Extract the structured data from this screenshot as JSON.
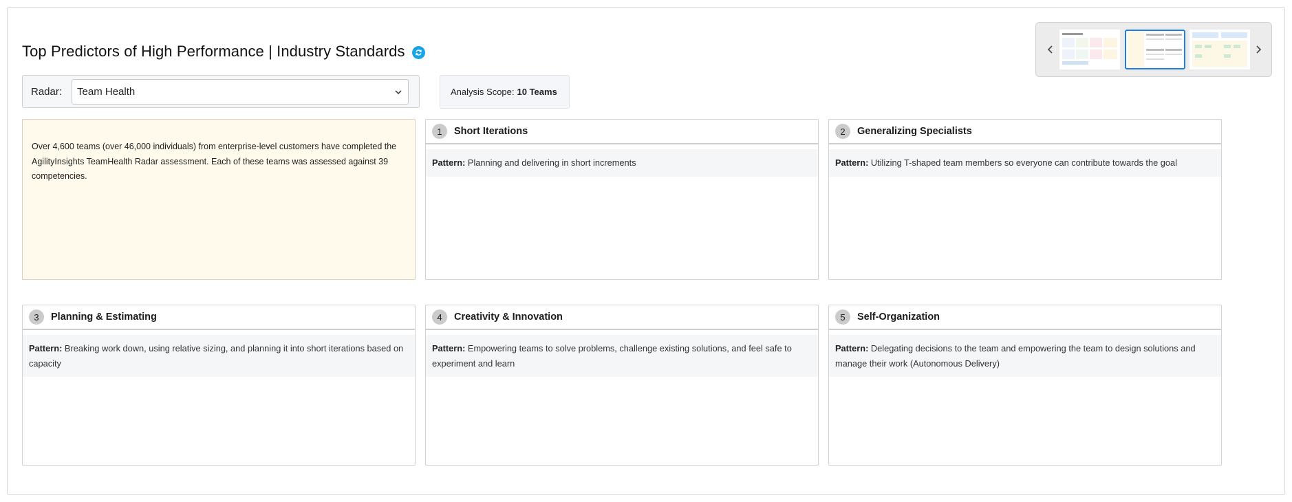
{
  "page": {
    "title": "Top Predictors of High Performance | Industry Standards"
  },
  "radar": {
    "label": "Radar:",
    "selected": "Team Health"
  },
  "scope": {
    "label": "Analysis Scope:",
    "value": "10 Teams"
  },
  "intro": {
    "text": "Over 4,600 teams (over 46,000 individuals) from enterprise-level customers have completed the AgilityInsights TeamHealth Radar assessment. Each of these teams was assessed against 39 competencies."
  },
  "pattern_label": "Pattern:",
  "cards": [
    {
      "number": "1",
      "title": "Short Iterations",
      "pattern": "Planning and delivering in short increments"
    },
    {
      "number": "2",
      "title": "Generalizing Specialists",
      "pattern": "Utilizing T-shaped team members so everyone can contribute towards the goal"
    },
    {
      "number": "3",
      "title": "Planning & Estimating",
      "pattern": "Breaking work down, using relative sizing, and planning it into short iterations based on capacity"
    },
    {
      "number": "4",
      "title": "Creativity & Innovation",
      "pattern": "Empowering teams to solve problems, challenge existing solutions, and feel safe to experiment and learn"
    },
    {
      "number": "5",
      "title": "Self-Organization",
      "pattern": "Delegating decisions to the team and empowering the team to design solutions and manage their work (Autonomous Delivery)"
    }
  ],
  "colors": {
    "refresh_icon": "#1aa3e8",
    "intro_background": "#fffaeb",
    "carousel_active_border": "#1f7de0"
  },
  "icons": {
    "refresh": "refresh-icon",
    "dropdown": "chevron-down-icon",
    "carousel_prev": "chevron-left-icon",
    "carousel_next": "chevron-right-icon"
  }
}
